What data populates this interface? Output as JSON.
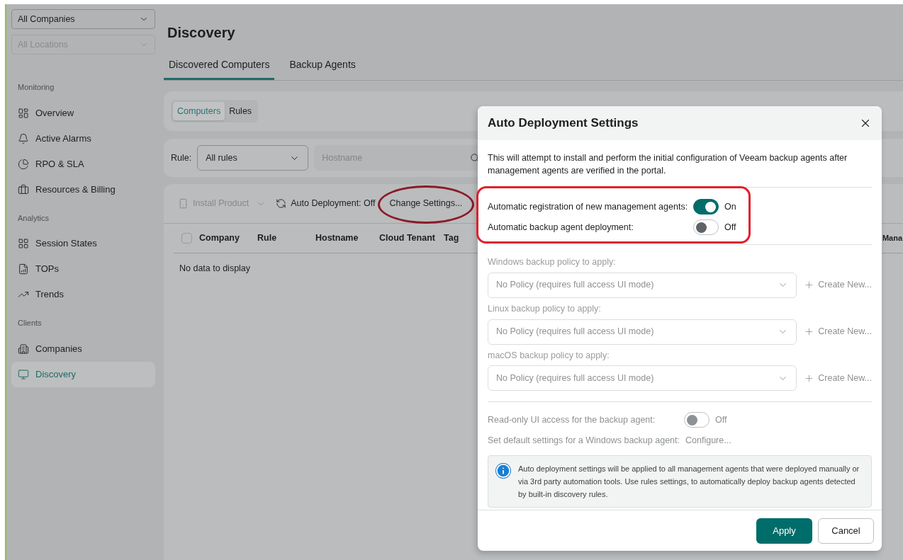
{
  "scope_selectors": [
    {
      "value": "All Companies",
      "disabled": false
    },
    {
      "value": "All Locations",
      "disabled": true
    }
  ],
  "sidebar": {
    "sections": [
      {
        "title": "Monitoring",
        "items": [
          {
            "label": "Overview",
            "selected": false
          },
          {
            "label": "Active Alarms",
            "selected": false
          },
          {
            "label": "RPO & SLA",
            "selected": false
          },
          {
            "label": "Resources & Billing",
            "selected": false
          }
        ]
      },
      {
        "title": "Analytics",
        "items": [
          {
            "label": "Session States",
            "selected": false
          },
          {
            "label": "TOPs",
            "selected": false
          },
          {
            "label": "Trends",
            "selected": false
          }
        ]
      },
      {
        "title": "Clients",
        "items": [
          {
            "label": "Companies",
            "selected": false
          },
          {
            "label": "Discovery",
            "selected": true
          }
        ]
      }
    ]
  },
  "page": {
    "title": "Discovery",
    "tabs": [
      {
        "label": "Discovered Computers",
        "selected": true
      },
      {
        "label": "Backup Agents",
        "selected": false
      }
    ],
    "sub_tabs": [
      {
        "label": "Computers",
        "selected": true
      },
      {
        "label": "Rules",
        "selected": false
      }
    ],
    "filter": {
      "rule_label": "Rule:",
      "rule_value": "All rules",
      "search_placeholder": "Hostname"
    },
    "toolbar": {
      "install_product": {
        "label": "Install Product",
        "disabled": true
      },
      "auto_deployment": "Auto Deployment: Off",
      "change_settings": "Change Settings..."
    },
    "table": {
      "select_all_checked": false,
      "columns": [
        "Company",
        "Rule",
        "Hostname",
        "Cloud Tenant",
        "Tag",
        "Mana"
      ],
      "empty_text": "No data to display"
    }
  },
  "dialog": {
    "title": "Auto Deployment Settings",
    "description": "This will attempt to install and perform the initial configuration of Veeam backup agents after management agents are verified in the portal.",
    "toggles": [
      {
        "label": "Automatic registration of new management agents:",
        "on": true,
        "state_text": "On"
      },
      {
        "label": "Automatic backup agent deployment:",
        "on": false,
        "state_text": "Off"
      }
    ],
    "policies_disabled": true,
    "policies": [
      {
        "label": "Windows backup policy to apply:",
        "value": "No Policy (requires full access UI mode)",
        "create": "Create New..."
      },
      {
        "label": "Linux backup policy to apply:",
        "value": "No Policy (requires full access UI mode)",
        "create": "Create New..."
      },
      {
        "label": "macOS backup policy to apply:",
        "value": "No Policy (requires full access UI mode)",
        "create": "Create New..."
      }
    ],
    "read_only_toggle": {
      "label": "Read-only UI access for the backup agent:",
      "on": false,
      "state_text": "Off",
      "disabled": true
    },
    "default_settings": {
      "label": "Set default settings for a Windows backup agent:",
      "link": "Configure...",
      "disabled": true
    },
    "info": "Auto deployment settings will be applied to all management agents that were deployed manually or via 3rd party automation tools. Use rules settings, to automatically deploy backup agents detected by built-in discovery rules.",
    "buttons": [
      {
        "label": "Apply",
        "kind": "primary"
      },
      {
        "label": "Cancel",
        "kind": "secondary"
      }
    ]
  }
}
